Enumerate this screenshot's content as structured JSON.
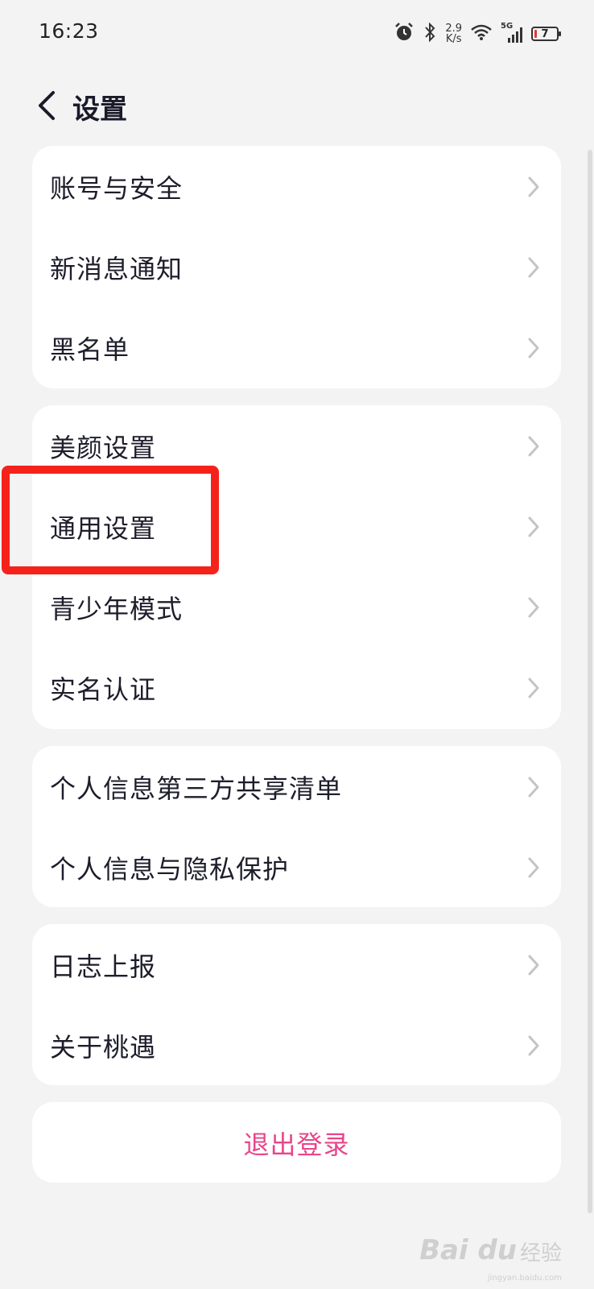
{
  "status_bar": {
    "time": "16:23",
    "net_speed_value": "2.9",
    "net_speed_unit": "K/s",
    "network_type": "5G",
    "battery_level": "7"
  },
  "header": {
    "title": "设置"
  },
  "groups": [
    {
      "items": [
        "账号与安全",
        "新消息通知",
        "黑名单"
      ]
    },
    {
      "items": [
        "美颜设置",
        "通用设置",
        "青少年模式",
        "实名认证"
      ]
    },
    {
      "items": [
        "个人信息第三方共享清单",
        "个人信息与隐私保护"
      ]
    },
    {
      "items": [
        "日志上报",
        "关于桃遇"
      ]
    }
  ],
  "logout": {
    "label": "退出登录"
  },
  "watermark": {
    "brand": "Bai du",
    "sub": "经验",
    "url": "jingyan.baidu.com"
  },
  "colors": {
    "background": "#f3f3f3",
    "card": "#ffffff",
    "logout_text": "#e8468a",
    "highlight": "#f5221b",
    "chevron": "#c4c4c4"
  }
}
